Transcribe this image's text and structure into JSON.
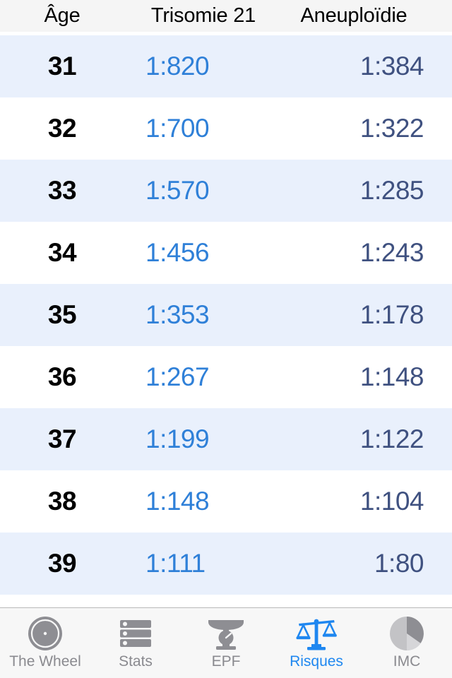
{
  "table": {
    "columns": [
      "Âge",
      "Trisomie 21",
      "Aneuploïdie"
    ],
    "rows": [
      {
        "age": "31",
        "trisomie": "1:820",
        "aneuploidie": "1:384"
      },
      {
        "age": "32",
        "trisomie": "1:700",
        "aneuploidie": "1:322"
      },
      {
        "age": "33",
        "trisomie": "1:570",
        "aneuploidie": "1:285"
      },
      {
        "age": "34",
        "trisomie": "1:456",
        "aneuploidie": "1:243"
      },
      {
        "age": "35",
        "trisomie": "1:353",
        "aneuploidie": "1:178"
      },
      {
        "age": "36",
        "trisomie": "1:267",
        "aneuploidie": "1:148"
      },
      {
        "age": "37",
        "trisomie": "1:199",
        "aneuploidie": "1:122"
      },
      {
        "age": "38",
        "trisomie": "1:148",
        "aneuploidie": "1:104"
      },
      {
        "age": "39",
        "trisomie": "1:111",
        "aneuploidie": "1:80"
      }
    ]
  },
  "tab_bar": {
    "active": "Risques",
    "items": [
      {
        "label": "The Wheel",
        "icon": "wheel-icon"
      },
      {
        "label": "Stats",
        "icon": "list-rows-icon"
      },
      {
        "label": "EPF",
        "icon": "weighing-scale-icon"
      },
      {
        "label": "Risques",
        "icon": "balance-scale-icon"
      },
      {
        "label": "IMC",
        "icon": "pie-chart-icon"
      }
    ]
  },
  "colors": {
    "accent_blue": "#2f80d8",
    "tab_active_blue": "#1f87f0",
    "aneuploidie_navy": "#3f5180",
    "row_alt_background": "#e9f0fc",
    "header_background": "#f5f5f5",
    "tab_bar_background": "#f7f7f7",
    "inactive_gray": "#8a8a8f"
  }
}
